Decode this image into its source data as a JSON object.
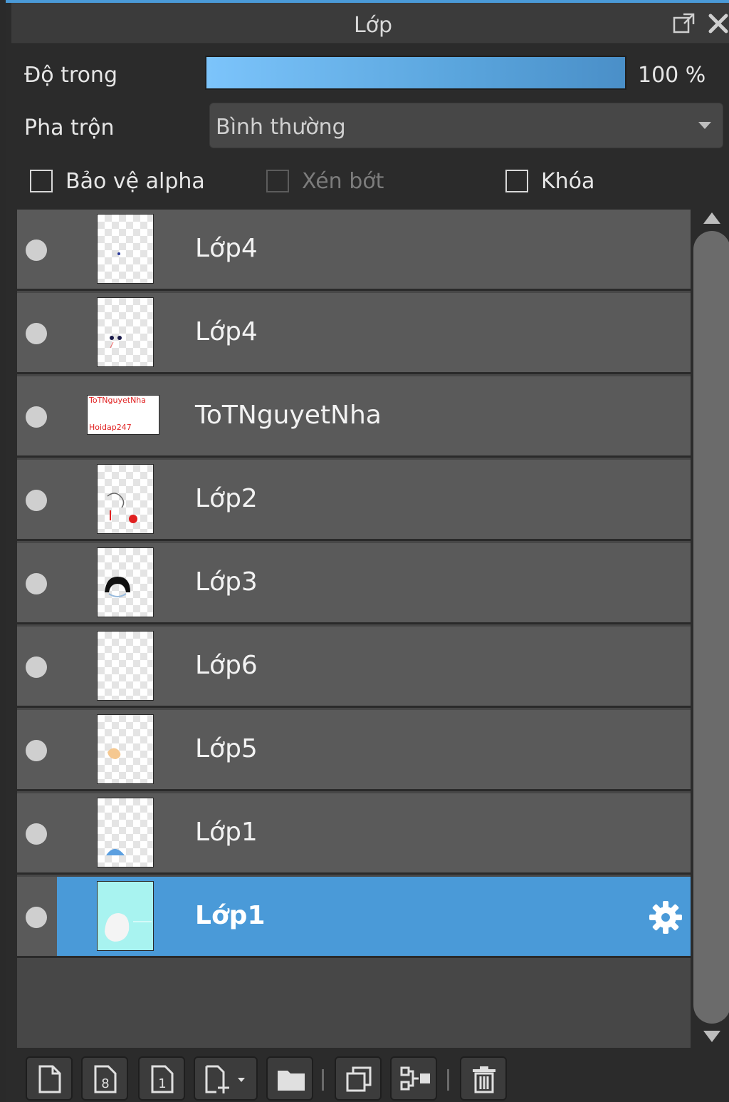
{
  "panel": {
    "title": "Lớp"
  },
  "opacity": {
    "label": "Độ trong",
    "value": "100 %",
    "level_percent": 100
  },
  "blend": {
    "label": "Pha trộn",
    "selected": "Bình thường"
  },
  "options": {
    "protect_alpha": "Bảo vệ alpha",
    "clip": "Xén bớt",
    "lock": "Khóa"
  },
  "layers": [
    {
      "name": "Lớp4"
    },
    {
      "name": "Lớp4"
    },
    {
      "name": "ToTNguyetNha",
      "thumb_text_1": "ToTNguyetNha",
      "thumb_text_2": "Hoidap247"
    },
    {
      "name": "Lớp2"
    },
    {
      "name": "Lớp3"
    },
    {
      "name": "Lớp6"
    },
    {
      "name": "Lớp5"
    },
    {
      "name": "Lớp1"
    },
    {
      "name": "Lớp1",
      "selected": true
    }
  ],
  "colors": {
    "accent": "#4a9ad8",
    "row": "#5a5a5a",
    "background": "#2b2b2b"
  },
  "toolbar_icons": [
    "new-layer-icon",
    "new-8bit-layer-icon",
    "new-1bit-layer-icon",
    "add-layer-dropdown-icon",
    "folder-icon",
    "duplicate-icon",
    "merge-icon",
    "trash-icon"
  ]
}
